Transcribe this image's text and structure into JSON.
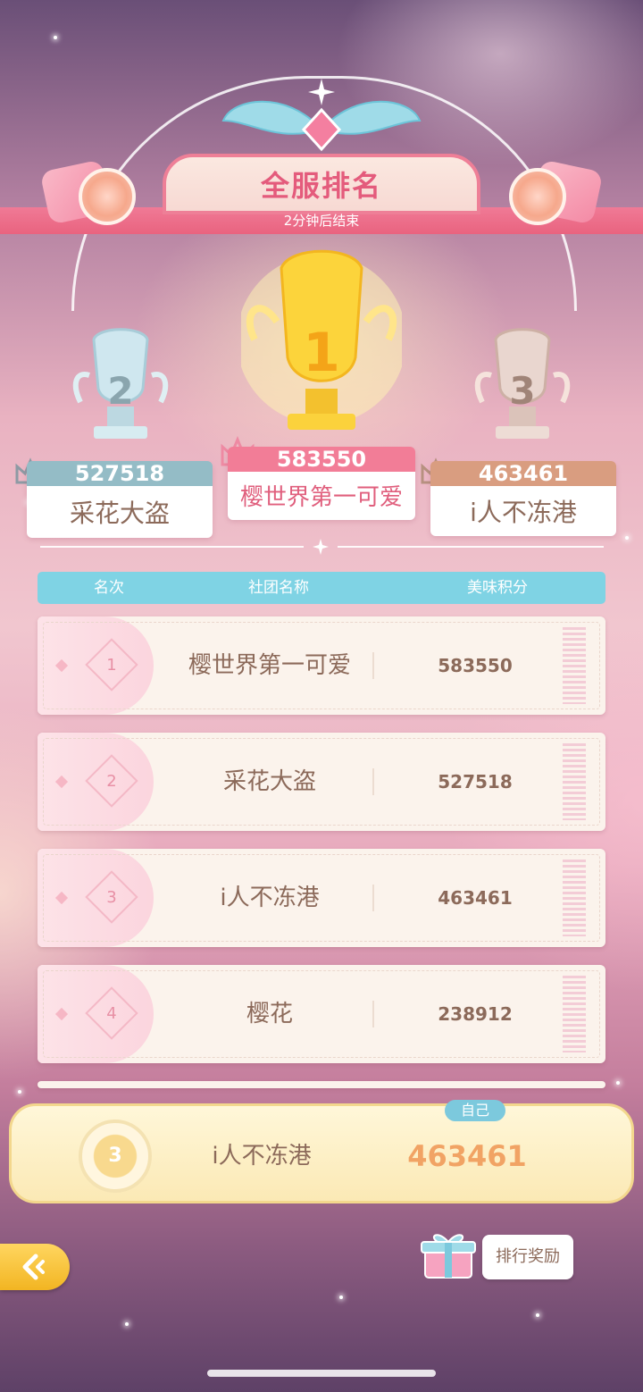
{
  "header": {
    "title": "全服排名",
    "timer": "2分钟后结束"
  },
  "podium": {
    "first": {
      "rank": "1",
      "score": "583550",
      "name": "樱世界第一可爱"
    },
    "second": {
      "rank": "2",
      "score": "527518",
      "name": "采花大盗"
    },
    "third": {
      "rank": "3",
      "score": "463461",
      "name": "i人不冻港"
    }
  },
  "table": {
    "headers": [
      "名次",
      "社团名称",
      "美味积分"
    ],
    "rows": [
      {
        "rank": "1",
        "name": "樱世界第一可爱",
        "score": "583550"
      },
      {
        "rank": "2",
        "name": "采花大盗",
        "score": "527518"
      },
      {
        "rank": "3",
        "name": "i人不冻港",
        "score": "463461"
      },
      {
        "rank": "4",
        "name": "樱花",
        "score": "238912"
      }
    ]
  },
  "self": {
    "tag": "自己",
    "rank": "3",
    "name": "i人不冻港",
    "score": "463461"
  },
  "reward_button": {
    "label": "排行奖励",
    "icon": "gift-box-icon"
  },
  "back_button": {
    "icon": "back-arrow-icon"
  },
  "colors": {
    "accent_pink": "#e45b7c",
    "table_header": "#7fd3e4",
    "gold": "#f1a364",
    "text_brown": "#8c6a5a"
  }
}
